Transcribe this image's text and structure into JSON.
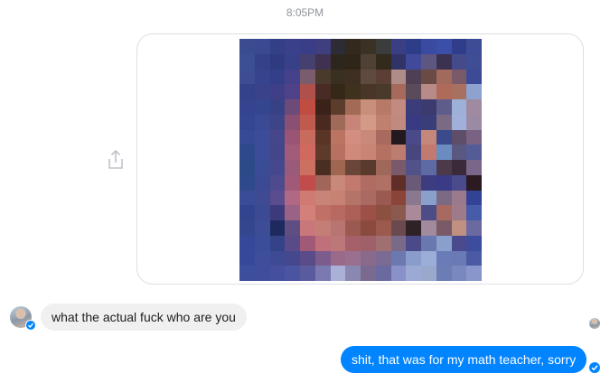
{
  "conversation": {
    "timestamp": "8:05PM",
    "messages": [
      {
        "sender": "me",
        "type": "image",
        "content": "pixelated-photo"
      },
      {
        "sender": "them",
        "type": "text",
        "text": "what the actual fuck who are you"
      },
      {
        "sender": "me",
        "type": "text",
        "text": "shit, that was for my math teacher, sorry"
      }
    ]
  },
  "icons": {
    "share": "share-icon",
    "delivered": "delivered-check-icon",
    "seen": "seen-avatar"
  },
  "colors": {
    "sent_bubble": "#0084ff",
    "received_bubble": "#f1f0f0",
    "timestamp_text": "#90949c"
  },
  "pixel_palette": [
    [
      "#3b4b8f",
      "#3a4a92",
      "#333f86",
      "#3a418a",
      "#393e86",
      "#3f3e7e",
      "#2d2b36",
      "#33291f",
      "#3b3225",
      "#3a3d3c",
      "#3a3f84",
      "#2d3d8a",
      "#394aa0",
      "#3b4fa8",
      "#2f3d8a",
      "#3c4d96"
    ],
    [
      "#3c4e94",
      "#334289",
      "#2f3b80",
      "#384188",
      "#46406f",
      "#3f3150",
      "#2c261d",
      "#2f2519",
      "#4f4234",
      "#322a1c",
      "#2f3366",
      "#414a9a",
      "#5c5680",
      "#3a3250",
      "#454b8a",
      "#3e4d94"
    ],
    [
      "#3d4d94",
      "#35448c",
      "#333f88",
      "#45418a",
      "#7a5c6c",
      "#4a3a2c",
      "#3a3021",
      "#3e2f22",
      "#5e4a3e",
      "#5b3e34",
      "#b08c88",
      "#4e3f55",
      "#6a4a44",
      "#a16a5c",
      "#7a5a6a",
      "#3d4b96"
    ],
    [
      "#33428a",
      "#3a428a",
      "#3e3f86",
      "#4e4388",
      "#b0504a",
      "#4a2a24",
      "#362818",
      "#3e321e",
      "#4a3628",
      "#4a3a2c",
      "#a56a5c",
      "#5a4a5a",
      "#b88a88",
      "#b06a5a",
      "#a87060",
      "#8ea2d0"
    ],
    [
      "#34448e",
      "#344690",
      "#374286",
      "#6e4a7a",
      "#c04c42",
      "#3b2218",
      "#5c3c2a",
      "#a36a55",
      "#c8907a",
      "#b87a68",
      "#c38a80",
      "#3b3c7a",
      "#3d3a70",
      "#5e5c8a",
      "#9db0d8",
      "#a08aa0"
    ],
    [
      "#354690",
      "#3a4a94",
      "#3e4488",
      "#8a5074",
      "#c05a4e",
      "#4a2a20",
      "#a06a58",
      "#c88478",
      "#d49a88",
      "#c08070",
      "#c08a80",
      "#3a3a82",
      "#3a3e78",
      "#7a6a84",
      "#a0b0d8",
      "#9a8aa4"
    ],
    [
      "#374a94",
      "#3c4c98",
      "#46468a",
      "#9a5474",
      "#c86a5c",
      "#5a3424",
      "#bc7462",
      "#d48e80",
      "#c8887a",
      "#a86a5e",
      "#231a20",
      "#4a4a8a",
      "#c4887a",
      "#3a4a8a",
      "#5e4e6a",
      "#7a6284"
    ],
    [
      "#2e4a8c",
      "#3c4c98",
      "#44468a",
      "#a05c78",
      "#d06a5e",
      "#5e3a2a",
      "#b87060",
      "#d08a7c",
      "#ca8474",
      "#b47060",
      "#bc7c70",
      "#48467e",
      "#c27a6e",
      "#6a8cc0",
      "#5a5880",
      "#545c98"
    ],
    [
      "#2d4a88",
      "#3a4c96",
      "#46488e",
      "#9a5a7a",
      "#cc7060",
      "#4a2e22",
      "#a06650",
      "#6a4638",
      "#5a3a2c",
      "#a0685a",
      "#7a5a6a",
      "#52528a",
      "#5e6aa4",
      "#4c3a4a",
      "#3a2a3a",
      "#7a6688"
    ],
    [
      "#2f4a8c",
      "#3c4a94",
      "#4e4a8e",
      "#a05a78",
      "#c04c4c",
      "#a2655a",
      "#c8887a",
      "#c27a6e",
      "#b06c62",
      "#b07064",
      "#602e28",
      "#6a5a78",
      "#3c3c80",
      "#3a3a86",
      "#4a4a8c",
      "#2b1a22"
    ],
    [
      "#3a4c96",
      "#3e4a92",
      "#5a4c8e",
      "#b06884",
      "#d07a74",
      "#c88478",
      "#c88274",
      "#b47468",
      "#a86a62",
      "#9a5a52",
      "#8a4438",
      "#8a7890",
      "#8aa0cc",
      "#7a6a84",
      "#9a7a8c",
      "#324294"
    ],
    [
      "#33448e",
      "#3c4a94",
      "#3d3a7c",
      "#9a6284",
      "#d4807a",
      "#c07066",
      "#b86a62",
      "#ac6058",
      "#9c5048",
      "#8c5040",
      "#8a5a50",
      "#aa8a9a",
      "#4c4c86",
      "#a86a60",
      "#9e7a8a",
      "#465ca8"
    ],
    [
      "#34478e",
      "#3c4c96",
      "#1e2a5e",
      "#5e4e82",
      "#c8787a",
      "#c47e76",
      "#b87470",
      "#9a5a52",
      "#8a4a3e",
      "#9c5a4e",
      "#6a4a4e",
      "#2e2226",
      "#a08a9c",
      "#7a5a66",
      "#c09080",
      "#6a6aa0"
    ],
    [
      "#35489a",
      "#3b4c98",
      "#344288",
      "#5a4a88",
      "#a05a78",
      "#c0707a",
      "#bc7878",
      "#a6606a",
      "#a0606a",
      "#a07070",
      "#7a6a8a",
      "#4a4a88",
      "#6a78b0",
      "#8aa0cc",
      "#4a4a8e",
      "#3d4c9c"
    ],
    [
      "#36489a",
      "#3e4e9a",
      "#3e4a94",
      "#46488e",
      "#5a4c88",
      "#7c5c8c",
      "#9a6a8a",
      "#9a7090",
      "#8a6a8a",
      "#7a6a94",
      "#6c78b0",
      "#8a9ccc",
      "#9aaed8",
      "#6a7cb8",
      "#6a7ab4",
      "#4a5aa4"
    ],
    [
      "#3c4e9c",
      "#3e4e9c",
      "#44509e",
      "#4a54a0",
      "#5a5a9e",
      "#7a7ab0",
      "#aab0d8",
      "#8a88b0",
      "#7a6a90",
      "#6a6aa0",
      "#8a90c8",
      "#9aaad4",
      "#9aa8cc",
      "#6c7cb4",
      "#7a88c0",
      "#8896cc"
    ]
  ]
}
